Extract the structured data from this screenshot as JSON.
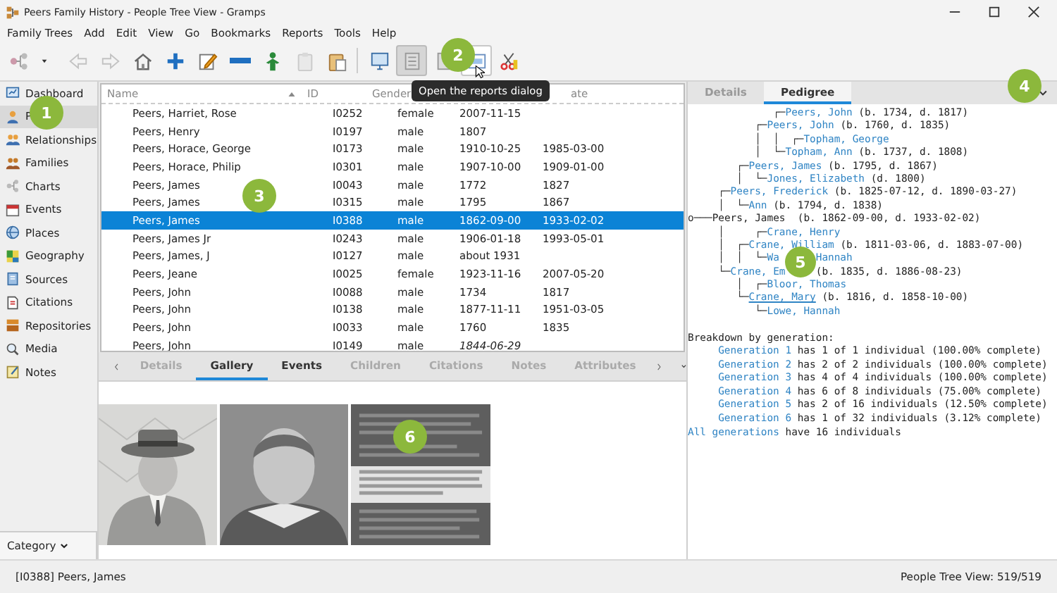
{
  "window": {
    "title": "Peers Family History - People Tree View - Gramps"
  },
  "menu": [
    "Family Trees",
    "Add",
    "Edit",
    "View",
    "Go",
    "Bookmarks",
    "Reports",
    "Tools",
    "Help"
  ],
  "toolbar": [
    {
      "kind": "button",
      "disabled": false,
      "hovered": false
    },
    {
      "kind": "dropdown",
      "hovered": false
    },
    {
      "kind": "button",
      "disabled": true,
      "hovered": false
    },
    {
      "kind": "button",
      "disabled": true,
      "hovered": false
    },
    {
      "kind": "button",
      "disabled": false,
      "hovered": false
    },
    {
      "kind": "button",
      "disabled": false,
      "hovered": false
    },
    {
      "kind": "button",
      "disabled": false,
      "hovered": false
    },
    {
      "kind": "button",
      "disabled": false,
      "hovered": false
    },
    {
      "kind": "button",
      "disabled": false,
      "hovered": false
    },
    {
      "kind": "button",
      "disabled": true,
      "hovered": false
    },
    {
      "kind": "button",
      "disabled": false,
      "hovered": false
    },
    {
      "kind": "separator"
    },
    {
      "kind": "button",
      "disabled": false,
      "hovered": false
    },
    {
      "kind": "toggle",
      "selected": true,
      "hovered": false
    },
    {
      "kind": "toggle",
      "selected": false,
      "hovered": false
    },
    {
      "kind": "button",
      "disabled": false,
      "hovered": true
    },
    {
      "kind": "button",
      "disabled": false,
      "hovered": false
    }
  ],
  "tooltip": "Open the reports dialog",
  "sidebar": {
    "items": [
      {
        "label": "Dashboard",
        "selected": false
      },
      {
        "label": "P",
        "selected": true
      },
      {
        "label": "Relationships",
        "selected": false
      },
      {
        "label": "Families",
        "selected": false
      },
      {
        "label": "Charts",
        "selected": false
      },
      {
        "label": "Events",
        "selected": false
      },
      {
        "label": "Places",
        "selected": false
      },
      {
        "label": "Geography",
        "selected": false
      },
      {
        "label": "Sources",
        "selected": false
      },
      {
        "label": "Citations",
        "selected": false
      },
      {
        "label": "Repositories",
        "selected": false
      },
      {
        "label": "Media",
        "selected": false
      },
      {
        "label": "Notes",
        "selected": false
      }
    ],
    "category": "Category"
  },
  "table": {
    "columns": [
      {
        "label": "Name",
        "sorted": true
      },
      {
        "label": "ID"
      },
      {
        "label": "Gender"
      },
      {},
      {
        "label": "ate"
      }
    ],
    "rows": [
      {
        "name": "Peers, Harriet, Rose",
        "id": "I0252",
        "gender": "female",
        "birth": "2007-11-15",
        "birth_fallback": false,
        "selected": false
      },
      {
        "name": "Peers, Henry",
        "id": "I0197",
        "gender": "male",
        "birth": "1807",
        "birth_fallback": false,
        "selected": false
      },
      {
        "name": "Peers, Horace, George",
        "id": "I0173",
        "gender": "male",
        "birth": "1910-10-25",
        "death": "1985-03-00",
        "birth_fallback": false,
        "selected": false
      },
      {
        "name": "Peers, Horace, Philip",
        "id": "I0301",
        "gender": "male",
        "birth": "1907-10-00",
        "death": "1909-01-00",
        "birth_fallback": false,
        "selected": false
      },
      {
        "name": "Peers, James",
        "id": "I0043",
        "gender": "male",
        "birth": "1772",
        "death": "1827",
        "birth_fallback": false,
        "selected": false
      },
      {
        "name": "Peers, James",
        "id": "I0315",
        "gender": "male",
        "birth": "1795",
        "death": "1867",
        "birth_fallback": false,
        "selected": false
      },
      {
        "name": "Peers, James",
        "id": "I0388",
        "gender": "male",
        "birth": "1862-09-00",
        "death": "1933-02-02",
        "birth_fallback": false,
        "selected": true
      },
      {
        "name": "Peers, James Jr",
        "id": "I0243",
        "gender": "male",
        "birth": "1906-01-18",
        "death": "1993-05-01",
        "birth_fallback": false,
        "selected": false
      },
      {
        "name": "Peers, James, J",
        "id": "I0127",
        "gender": "male",
        "birth": "about 1931",
        "birth_fallback": false,
        "selected": false
      },
      {
        "name": "Peers, Jeane",
        "id": "I0025",
        "gender": "female",
        "birth": "1923-11-16",
        "death": "2007-05-20",
        "birth_fallback": false,
        "selected": false
      },
      {
        "name": "Peers, John",
        "id": "I0088",
        "gender": "male",
        "birth": "1734",
        "death": "1817",
        "birth_fallback": false,
        "selected": false
      },
      {
        "name": "Peers, John",
        "id": "I0138",
        "gender": "male",
        "birth": "1877-11-11",
        "death": "1951-03-05",
        "birth_fallback": false,
        "selected": false
      },
      {
        "name": "Peers, John",
        "id": "I0033",
        "gender": "male",
        "birth": "1760",
        "death": "1835",
        "birth_fallback": false,
        "selected": false
      },
      {
        "name": "Peers, John",
        "id": "I0149",
        "gender": "male",
        "birth": "1844-06-29",
        "birth_fallback": true,
        "selected": false
      }
    ]
  },
  "bottom_tabs": [
    {
      "label": "Details",
      "selected": false,
      "disabled": true
    },
    {
      "label": "Gallery",
      "selected": true,
      "disabled": false
    },
    {
      "label": "Events",
      "selected": false,
      "disabled": false
    },
    {
      "label": "Children",
      "selected": false,
      "disabled": true
    },
    {
      "label": "Citations",
      "selected": false,
      "disabled": true
    },
    {
      "label": "Notes",
      "selected": false,
      "disabled": true
    },
    {
      "label": "Attributes",
      "selected": false,
      "disabled": true
    }
  ],
  "gallery": [
    {
      "kind": "picture"
    },
    {
      "kind": "picture"
    },
    {
      "kind": "picture"
    }
  ],
  "right_tabs": [
    {
      "label": "Details",
      "selected": false
    },
    {
      "label": "Pedigree",
      "selected": true
    }
  ],
  "pedigree": {
    "lines": [
      {
        "prefix": "              ┌─",
        "name": "Peers, John",
        "rest": " (b. 1734, d. 1817)",
        "hovered": false
      },
      {
        "prefix": "           ┌─",
        "name": "Peers, John",
        "rest": " (b. 1760, d. 1835)",
        "hovered": false
      },
      {
        "prefix": "           │  │  ┌─",
        "name": "Topham, George",
        "hovered": false
      },
      {
        "prefix": "           │  └─",
        "name": "Topham, Ann",
        "rest": " (b. 1737, d. 1808)",
        "hovered": false
      },
      {
        "prefix": "        ┌─",
        "name": "Peers, James",
        "rest": " (b. 1795, d. 1867)",
        "hovered": false
      },
      {
        "prefix": "        │  └─",
        "name": "Jones, Elizabeth",
        "rest": " (d. 1800)",
        "hovered": false
      },
      {
        "prefix": "     ┌─",
        "name": "Peers, Frederick",
        "rest": " (b. 1825-07-12, d. 1890-03-27)",
        "hovered": false
      },
      {
        "prefix": "     │  └─",
        "name": "Ann",
        "rest": " (b. 1794, d. 1838)",
        "hovered": false
      },
      {
        "prefix": "o───",
        "plain": "Peers, James  (b. 1862-09-00, d. 1933-02-02)",
        "hovered": false
      },
      {
        "prefix": "     │     ┌─",
        "name": "Crane, Henry",
        "hovered": false
      },
      {
        "prefix": "     │  ┌─",
        "name": "Crane, William",
        "rest": " (b. 1811-03-06, d. 1883-07-00)",
        "hovered": false
      },
      {
        "prefix": "     │  │  └─",
        "name": "Wa",
        "name2": "Hannah",
        "hovered": false
      },
      {
        "prefix": "     └─",
        "name": "Crane, Em",
        "rest": "(b. 1835, d. 1886-08-23)",
        "hovered": false
      },
      {
        "prefix": "        │  ┌─",
        "name": "Bloor, Thomas",
        "hovered": false
      },
      {
        "prefix": "        └─",
        "name": "Crane, Mary",
        "rest": " (b. 1816, d. 1858-10-00)",
        "hovered": true
      },
      {
        "prefix": "           └─",
        "name": "Lowe, Hannah",
        "hovered": false
      }
    ],
    "heading": "Breakdown by generation:",
    "generations": [
      {
        "label": "Generation 1",
        "text": " has 1 of 1 individual (100.00% complete)"
      },
      {
        "label": "Generation 2",
        "text": " has 2 of 2 individuals (100.00% complete)"
      },
      {
        "label": "Generation 3",
        "text": " has 4 of 4 individuals (100.00% complete)"
      },
      {
        "label": "Generation 4",
        "text": " has 6 of 8 individuals (75.00% complete)"
      },
      {
        "label": "Generation 5",
        "text": " has 2 of 16 individuals (12.50% complete)"
      },
      {
        "label": "Generation 6",
        "text": " has 1 of 32 individuals (3.12% complete)"
      }
    ],
    "total": {
      "label": "All generations",
      "text": " have 16 individuals"
    }
  },
  "status_bar": {
    "left": "[I0388] Peers, James",
    "right": "People Tree View: 519/519"
  },
  "badges": [
    "1",
    "2",
    "3",
    "4",
    "5",
    "6"
  ]
}
